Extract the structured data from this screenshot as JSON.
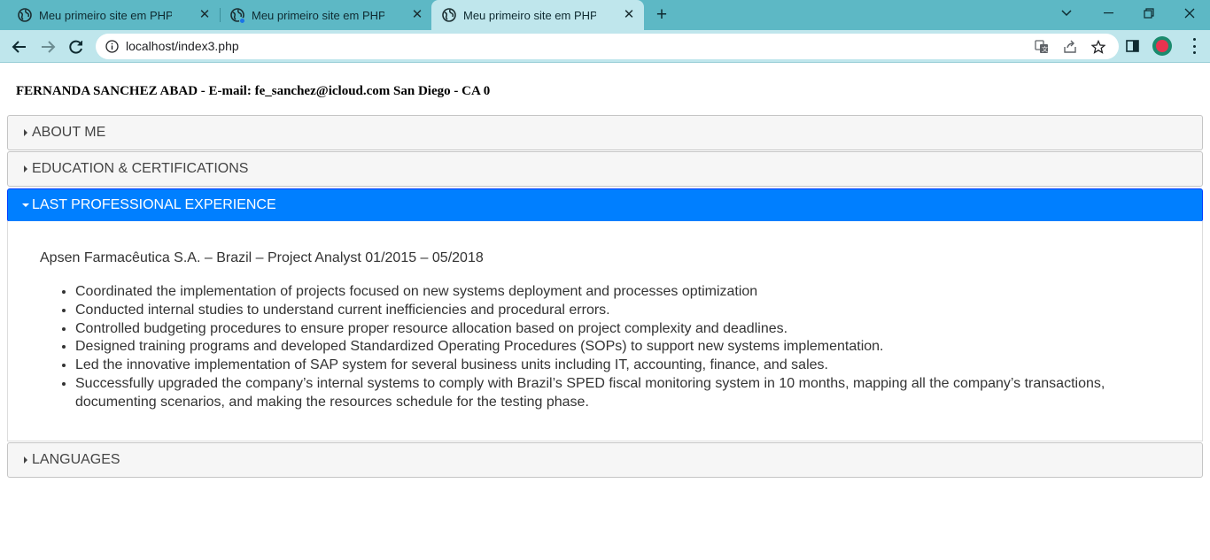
{
  "browser": {
    "tabs": [
      {
        "title": "Meu primeiro site em PHP! Wook",
        "close": "✕"
      },
      {
        "title": "Meu primeiro site em PHP! Wook",
        "close": "✕"
      },
      {
        "title": "Meu primeiro site em PHP! Wook",
        "close": "✕"
      }
    ],
    "new_tab": "+",
    "url": "localhost/index3.php",
    "accent": "#5db8c5",
    "toolbar_color": "#bfe6ec"
  },
  "page": {
    "header": "FERNANDA SANCHEZ ABAD - E-mail: fe_sanchez@icloud.com San Diego - CA 0",
    "sections": [
      {
        "label": "ABOUT ME",
        "expanded": false
      },
      {
        "label": "EDUCATION & CERTIFICATIONS",
        "expanded": false
      },
      {
        "label": "LAST PROFESSIONAL EXPERIENCE",
        "expanded": true
      },
      {
        "label": "LANGUAGES",
        "expanded": false
      }
    ],
    "active_color": "#007fff",
    "experience": {
      "job": "Apsen Farmacêutica S.A. – Brazil – Project Analyst 01/2015 – 05/2018",
      "bullets": [
        "Coordinated the implementation of projects focused on new systems deployment and processes optimization",
        "Conducted internal studies to understand current inefficiencies and procedural errors.",
        "Controlled budgeting procedures to ensure proper resource allocation based on project complexity and deadlines.",
        "Designed training programs and developed Standardized Operating Procedures (SOPs) to support new systems implementation.",
        "Led the innovative implementation of SAP system for several business units including IT, accounting, finance, and sales.",
        "Successfully upgraded the company’s internal systems to comply with Brazil’s SPED fiscal monitoring system in 10 months, mapping all the company’s transactions, documenting scenarios, and making the resources schedule for the testing phase."
      ]
    }
  }
}
